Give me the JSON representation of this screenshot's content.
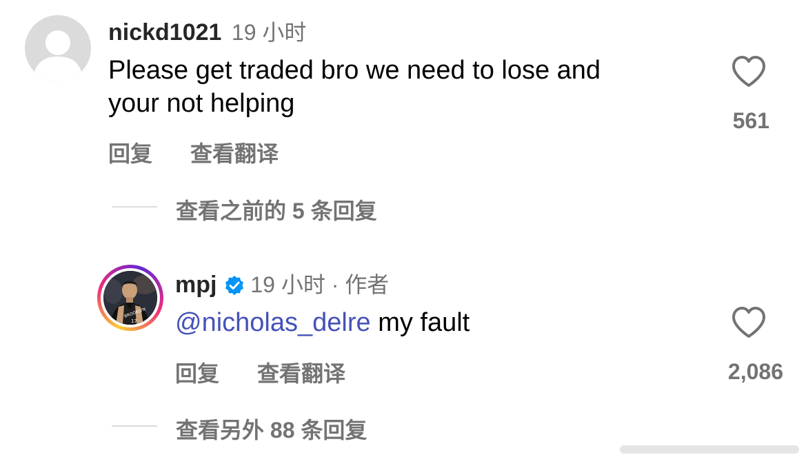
{
  "comments": [
    {
      "username": "nickd1021",
      "timestamp": "19 小时",
      "text": "Please get traded bro we need to lose and your not helping",
      "text_line1": "Please get traded bro we need to lose and",
      "text_line2": "your not helping",
      "reply_label": "回复",
      "translate_label": "查看翻译",
      "likes": "561",
      "view_replies": "查看之前的 5 条回复"
    },
    {
      "username": "mpj",
      "verified": true,
      "timestamp": "19 小时",
      "author_tag": " · 作者",
      "mention": "@nicholas_delre",
      "text_rest": " my fault",
      "reply_label": "回复",
      "translate_label": "查看翻译",
      "likes": "2,086",
      "view_replies": "查看另外 88 条回复"
    }
  ],
  "colors": {
    "mention": "#4552b8",
    "secondary_text": "#737373",
    "verified": "#0095f6"
  },
  "icons": {
    "like": "heart-outline-icon",
    "verified": "verified-badge-icon",
    "default_avatar": "default-avatar-icon"
  }
}
